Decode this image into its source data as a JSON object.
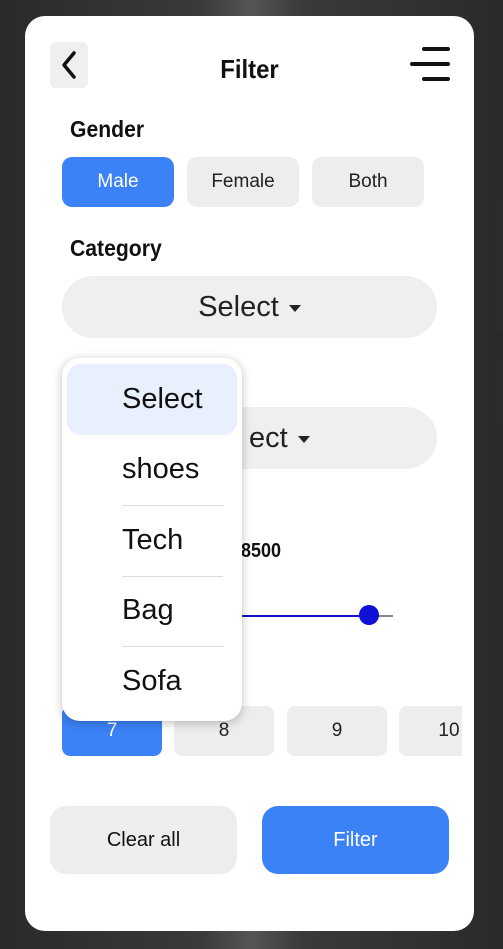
{
  "header": {
    "title": "Filter",
    "back_icon": "chevron-left-icon",
    "menu_icon": "menu-icon"
  },
  "gender": {
    "label": "Gender",
    "options": [
      "Male",
      "Female",
      "Both"
    ],
    "selected": "Male"
  },
  "category": {
    "label": "Category",
    "value": "Select"
  },
  "brand": {
    "value_partial": "ect"
  },
  "price": {
    "value_partial": "8500",
    "slider_fraction": 0.89
  },
  "sizes": {
    "options": [
      "7",
      "8",
      "9",
      "10"
    ],
    "selected": "7"
  },
  "dropdown": {
    "items": [
      "Select",
      "shoes",
      "Tech",
      "Bag",
      "Sofa"
    ],
    "selected": "Select"
  },
  "actions": {
    "clear_label": "Clear all",
    "filter_label": "Filter"
  },
  "colors": {
    "accent": "#3b82f6",
    "slider": "#1010d9",
    "chip_bg": "#ededed"
  }
}
